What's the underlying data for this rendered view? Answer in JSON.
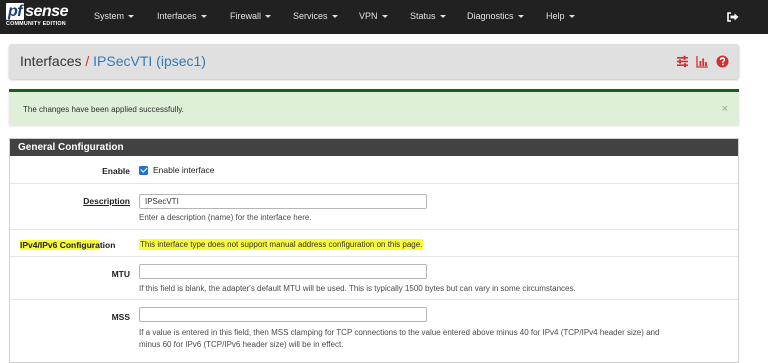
{
  "brand": {
    "logo_pf": "pf",
    "logo_sense": "sense",
    "logo_subtitle": "COMMUNITY EDITION"
  },
  "nav": {
    "items": [
      {
        "label": "System"
      },
      {
        "label": "Interfaces"
      },
      {
        "label": "Firewall"
      },
      {
        "label": "Services"
      },
      {
        "label": "VPN"
      },
      {
        "label": "Status"
      },
      {
        "label": "Diagnostics"
      },
      {
        "label": "Help"
      }
    ],
    "logout_icon": "sign-out-icon"
  },
  "breadcrumb": {
    "base": "Interfaces",
    "separator": "/",
    "current": "IPSecVTI (ipsec1)",
    "icons": [
      "sliders-icon",
      "bar-chart-icon",
      "question-circle-icon"
    ],
    "icon_color": "#d32f2f"
  },
  "alert": {
    "message": "The changes have been applied successfully.",
    "close": "×",
    "color": "#dff0d8"
  },
  "panel": {
    "title": "General Configuration",
    "enable": {
      "label": "Enable",
      "checkbox_label": "Enable interface",
      "checked": true
    },
    "description": {
      "label": "Description",
      "value": "IPSecVTI",
      "help": "Enter a description (name) for the interface here."
    },
    "ipconfig": {
      "label": "IPv4/IPv6 Configuration",
      "label_highlighted": "IPv4/IPv6 Configura",
      "label_rest": "tion",
      "message": "This interface type does not support manual address configuration on this page.",
      "highlight_color": "#f9f93d"
    },
    "mtu": {
      "label": "MTU",
      "value": "",
      "help": "If this field is blank, the adapter's default MTU will be used. This is typically 1500 bytes but can vary in some circumstances."
    },
    "mss": {
      "label": "MSS",
      "value": "",
      "help_line1": "If a value is entered in this field, then MSS clamping for TCP connections to the value entered above minus 40 for IPv4 (TCP/IPv4 header size) and",
      "help_line2": "minus 60 for IPv6 (TCP/IPv6 header size) will be in effect."
    }
  }
}
